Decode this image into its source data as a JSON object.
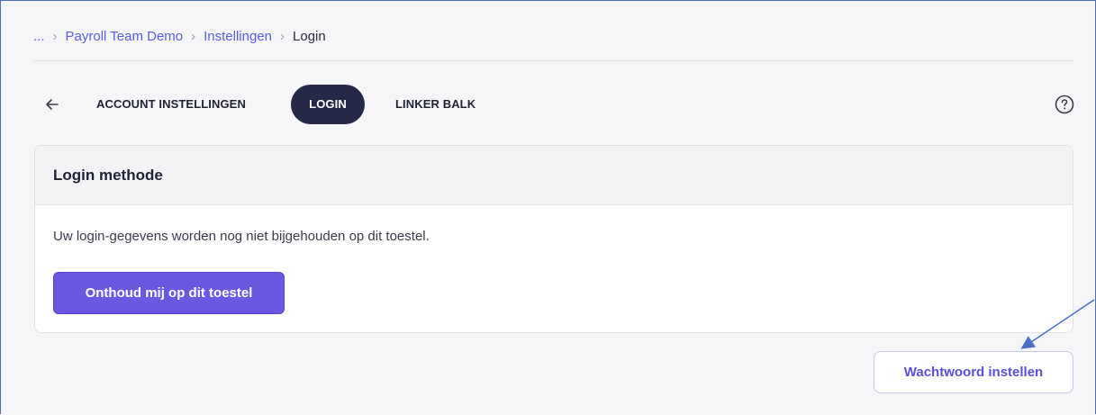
{
  "breadcrumb": {
    "ellipsis": "...",
    "items": [
      {
        "label": "Payroll Team Demo"
      },
      {
        "label": "Instellingen"
      },
      {
        "label": "Login"
      }
    ],
    "separator": "›"
  },
  "tabs": {
    "back_icon": "arrow-left-icon",
    "items": [
      {
        "label": "ACCOUNT INSTELLINGEN",
        "active": false
      },
      {
        "label": "LOGIN",
        "active": true
      },
      {
        "label": "LINKER BALK",
        "active": false
      }
    ],
    "help_icon": "question-circle-icon"
  },
  "card": {
    "title": "Login methode",
    "description": "Uw login-gegevens worden nog niet bijgehouden op dit toestel.",
    "button_label": "Onthoud mij op dit toestel"
  },
  "actions": {
    "set_password_label": "Wachtwoord instellen"
  },
  "colors": {
    "accent": "#6b58e0",
    "active_tab": "#252848",
    "link": "#5b5ce2",
    "annotation": "#4a6fc4"
  }
}
